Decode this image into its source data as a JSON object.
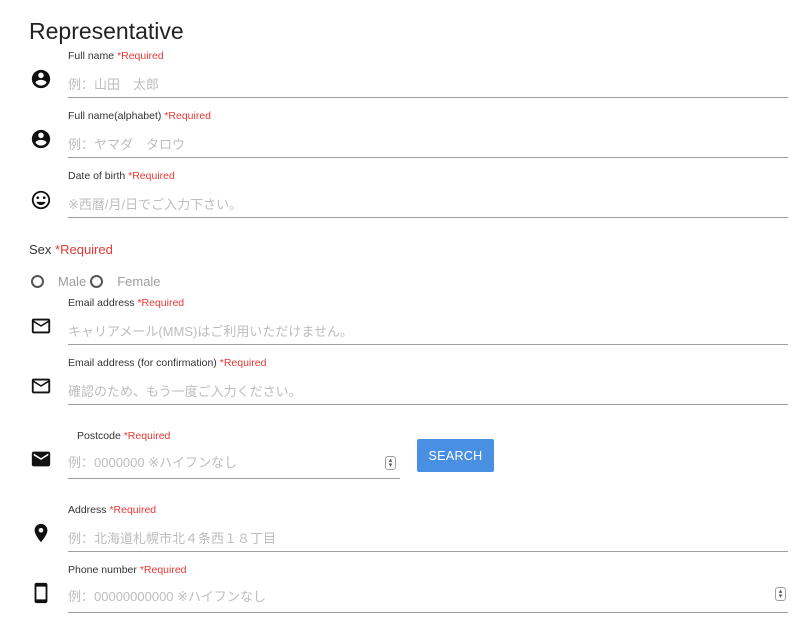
{
  "section_title": "Representative",
  "required_marker": "*Required",
  "fields": {
    "full_name": {
      "label": "Full name",
      "placeholder": "例：山田　太郎"
    },
    "full_name_alpha": {
      "label": "Full name(alphabet)",
      "placeholder": "例：ヤマダ　タロウ"
    },
    "dob": {
      "label": "Date of birth",
      "placeholder": "※西暦/月/日でご入力下さい。"
    },
    "email": {
      "label": "Email address",
      "placeholder": "キャリアメール(MMS)はご利用いただけません。"
    },
    "email_confirm": {
      "label": "Email address (for confirmation)",
      "placeholder": "確認のため、もう一度ご入力ください。"
    },
    "postcode": {
      "label": "Postcode",
      "placeholder": "例：0000000 ※ハイフンなし"
    },
    "address": {
      "label": "Address",
      "placeholder": "例：北海道札幌市北４条西１８丁目"
    },
    "phone": {
      "label": "Phone number",
      "placeholder": "例：00000000000 ※ハイフンなし"
    }
  },
  "sex": {
    "label": "Sex",
    "options": [
      "Male",
      "Female"
    ]
  },
  "search_button": "SEARCH",
  "icons": [
    "account-circle-icon",
    "smiley-icon",
    "mail-outline-icon",
    "mail-filled-icon",
    "location-pin-icon",
    "smartphone-icon"
  ]
}
